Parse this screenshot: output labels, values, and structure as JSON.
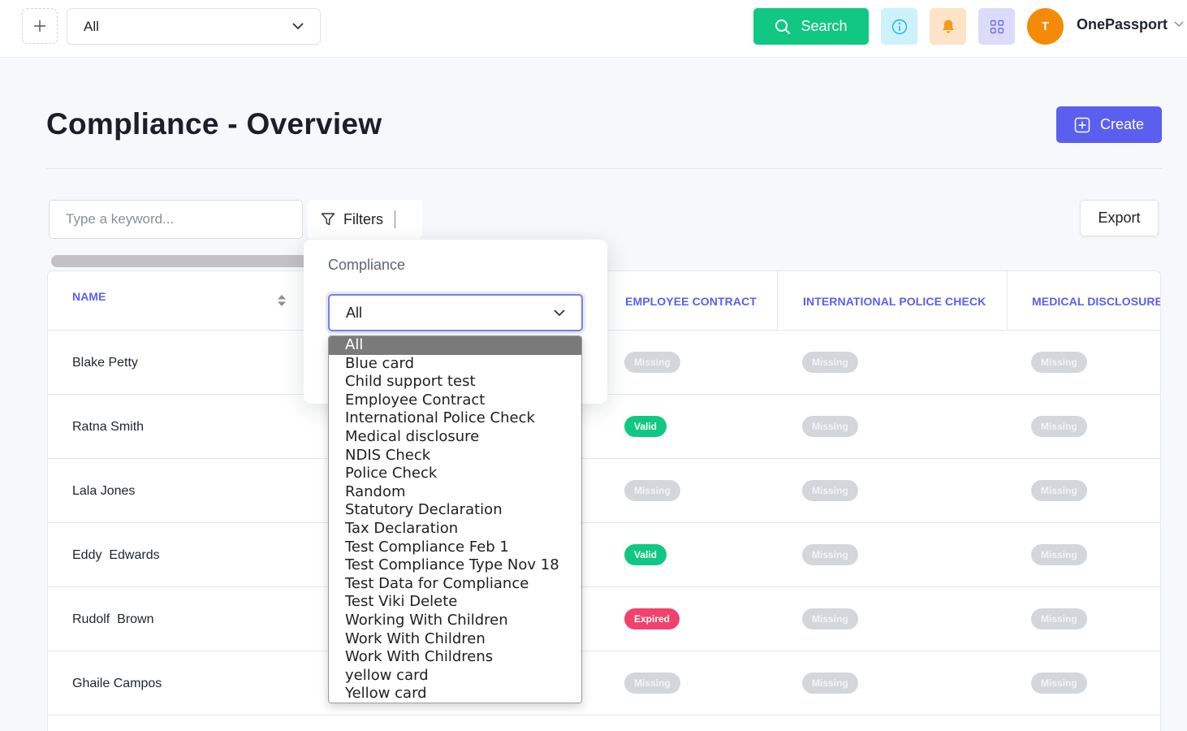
{
  "topbar": {
    "workspace_value": "All",
    "search_label": "Search",
    "avatar_initial": "T",
    "brand": "OnePassport"
  },
  "page": {
    "title": "Compliance - Overview",
    "create_label": "Create"
  },
  "filters": {
    "keyword_placeholder": "Type a keyword...",
    "filters_label": "Filters",
    "export_label": "Export"
  },
  "popup": {
    "label": "Compliance",
    "selected": "All",
    "options": [
      "All",
      "Blue card",
      "Child support test",
      "Employee Contract",
      "International Police Check",
      "Medical disclosure",
      "NDIS Check",
      "Police Check",
      "Random",
      "Statutory Declaration",
      "Tax Declaration",
      "Test Compliance Feb 1",
      "Test Compliance Type Nov 18",
      "Test Data for Compliance",
      "Test Viki Delete",
      "Working With Children",
      "Work With Children",
      "Work With Childrens",
      "yellow card",
      "Yellow card"
    ]
  },
  "table": {
    "columns": [
      "NAME",
      "EMPLOYEE CONTRACT",
      "INTERNATIONAL POLICE CHECK",
      "MEDICAL DISCLOSURE"
    ],
    "rows": [
      {
        "name": "Blake Petty",
        "employee_contract": "Missing",
        "international_police_check": "Missing",
        "medical_disclosure": "Missing"
      },
      {
        "name": "Ratna Smith",
        "employee_contract": "Valid",
        "international_police_check": "Missing",
        "medical_disclosure": "Missing"
      },
      {
        "name": "Lala Jones",
        "employee_contract": "Missing",
        "international_police_check": "Missing",
        "medical_disclosure": "Missing"
      },
      {
        "name": "Eddy  Edwards",
        "employee_contract": "Valid",
        "international_police_check": "Missing",
        "medical_disclosure": "Missing"
      },
      {
        "name": "Rudolf  Brown",
        "employee_contract": "Expired",
        "international_police_check": "Missing",
        "medical_disclosure": "Missing"
      },
      {
        "name": "Ghaile Campos",
        "employee_contract": "Missing",
        "international_police_check": "Missing",
        "medical_disclosure": "Missing"
      }
    ]
  },
  "colors": {
    "accent": "#5b5ff0",
    "search_green": "#11c784",
    "valid": "#11c784",
    "expired": "#f1416c",
    "missing": "#d3d6db"
  }
}
